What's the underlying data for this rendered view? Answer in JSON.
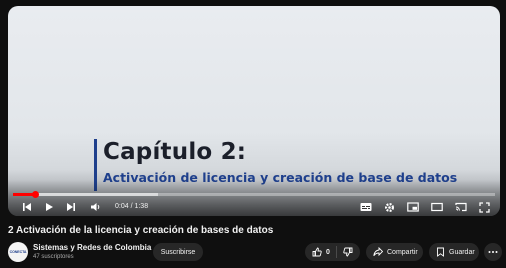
{
  "video": {
    "chapter_title": "Capítulo 2:",
    "chapter_subtitle": "Activación de licencia y creación de base de datos",
    "time_display": "0:04 / 1:38",
    "progress_fraction": 0.045,
    "buffer_fraction": 0.3,
    "title": "2 Activación de la licencia y creación de bases de datos"
  },
  "channel": {
    "name": "Sistemas y Redes de Colombia",
    "subscribers": "47 suscriptores",
    "avatar_text": "CONECTA"
  },
  "actions": {
    "subscribe_label": "Suscribirse",
    "like_count": "0",
    "share_label": "Compartir",
    "save_label": "Guardar"
  },
  "icons": [
    "previous-icon",
    "play-icon",
    "next-icon",
    "volume-icon",
    "subtitles-icon",
    "settings-icon",
    "miniplayer-icon",
    "theater-icon",
    "cast-icon",
    "fullscreen-icon",
    "like-icon",
    "dislike-icon",
    "share-icon",
    "save-icon",
    "more-icon"
  ],
  "colors": {
    "accent": "#ff0000",
    "chapter_bar": "#1e3f8c",
    "pill_bg": "#272727",
    "page_bg": "#0f0f0f"
  }
}
